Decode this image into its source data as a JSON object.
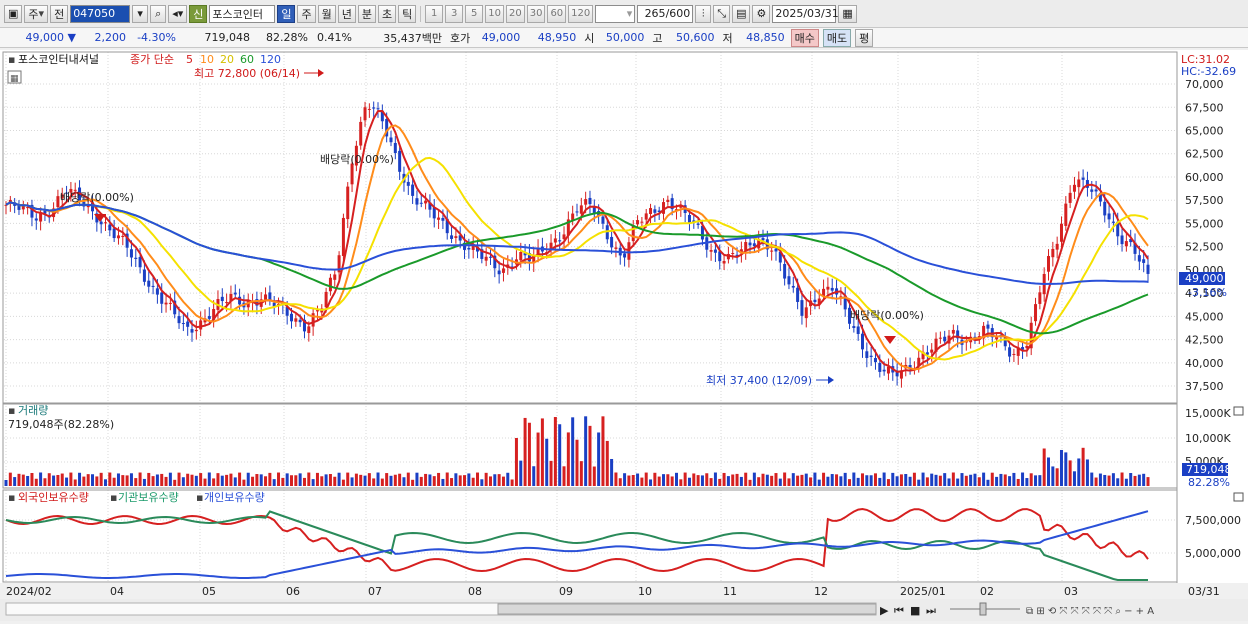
{
  "toolbar": {
    "period_label": "주",
    "prev_label": "전",
    "code": "047050",
    "new_badge": "신",
    "stock_name": "포스코인터",
    "periods": [
      "일",
      "주",
      "월",
      "년",
      "분",
      "초",
      "틱"
    ],
    "active_period": "일",
    "intervals": [
      "1",
      "3",
      "5",
      "10",
      "20",
      "30",
      "60",
      "120"
    ],
    "count_value": "265",
    "count_max": "/600",
    "date": "2025/03/31"
  },
  "quote": {
    "price": "49,000",
    "arrow": "▼",
    "change": "2,200",
    "change_pct": "-4.30%",
    "volume": "719,048",
    "vol_ratio": "82.28%",
    "turnover": "0.41%",
    "amount": "35,437백만",
    "bid_label": "호가",
    "ask_price": "49,000",
    "bid_price": "48,950",
    "open_label": "시",
    "open": "50,000",
    "high_label": "고",
    "high": "50,600",
    "low_label": "저",
    "low": "48,850",
    "buy_label": "매수",
    "sell_label": "매도",
    "eval_label": "평"
  },
  "chart": {
    "stock_title": "포스코인터내셔널",
    "price_label": "종가 단순",
    "ma_periods": [
      "5",
      "10",
      "20",
      "60",
      "120"
    ],
    "lc_label": "LC:31.02",
    "hc_label": "HC:-32.69",
    "price_ticks": [
      "70,000",
      "67,500",
      "65,000",
      "62,500",
      "60,000",
      "57,500",
      "55,000",
      "52,500",
      "50,000",
      "47,500",
      "45,000",
      "42,500",
      "40,000",
      "37,500"
    ],
    "current_price": "49,000",
    "current_pct": "-3.16%",
    "high_note": "최고 72,800 (06/14)",
    "low_note": "최저 37,400 (12/09)",
    "dividend_notes": [
      "배당락(0.00%)",
      "배당락(0.00%)",
      "배당락(0.00%)"
    ],
    "volume_title": "거래량",
    "volume_info": "719,048주(82.28%)",
    "volume_ticks": [
      "15,000K",
      "10,000K",
      "5,000K"
    ],
    "volume_current": "719,048",
    "volume_pct": "82.28%",
    "holdings_legend": [
      "외국인보유수량",
      "기관보유수량",
      "개인보유수량"
    ],
    "holdings_ticks": [
      "7,500,000",
      "5,000,000"
    ],
    "x_labels": [
      "2024/02",
      "04",
      "05",
      "06",
      "07",
      "08",
      "09",
      "10",
      "11",
      "12",
      "2025/01",
      "02",
      "03",
      "03/31"
    ]
  },
  "chart_data": {
    "type": "candlestick",
    "title": "포스코인터내셔널",
    "ylim": [
      36000,
      72800
    ],
    "x_range": [
      "2024/02",
      "2025/03/31"
    ],
    "high": {
      "value": 72800,
      "date": "06/14"
    },
    "low": {
      "value": 37400,
      "date": "12/09"
    },
    "last": {
      "close": 49000,
      "open": 50000,
      "high": 50600,
      "low": 48850
    },
    "series_close": [
      57000,
      56500,
      55800,
      56500,
      58500,
      57500,
      56000,
      54000,
      52500,
      50000,
      47500,
      45500,
      43500,
      44500,
      46000,
      47000,
      46500,
      47000,
      46000,
      45000,
      44000,
      46000,
      50000,
      62000,
      68000,
      66000,
      62000,
      58000,
      56500,
      55000,
      53500,
      52000,
      51000,
      50000,
      51500,
      51000,
      52500,
      54000,
      56500,
      57000,
      54000,
      51000,
      55000,
      56500,
      57500,
      56000,
      54500,
      52000,
      51000,
      52000,
      53500,
      52500,
      48500,
      45500,
      47500,
      48000,
      45000,
      42000,
      39500,
      38500,
      39500,
      41000,
      42000,
      43000,
      42500,
      43500,
      42500,
      41000,
      42500,
      49000,
      53500,
      60000,
      59000,
      56500,
      54000,
      52500,
      49000
    ]
  },
  "colors": {
    "ma5": "#d62020",
    "ma10": "#ff8c1a",
    "ma20": "#f5e100",
    "ma60": "#1a9a2a",
    "ma120": "#2a50d8",
    "up": "#d62020",
    "down": "#1a3fc4"
  }
}
